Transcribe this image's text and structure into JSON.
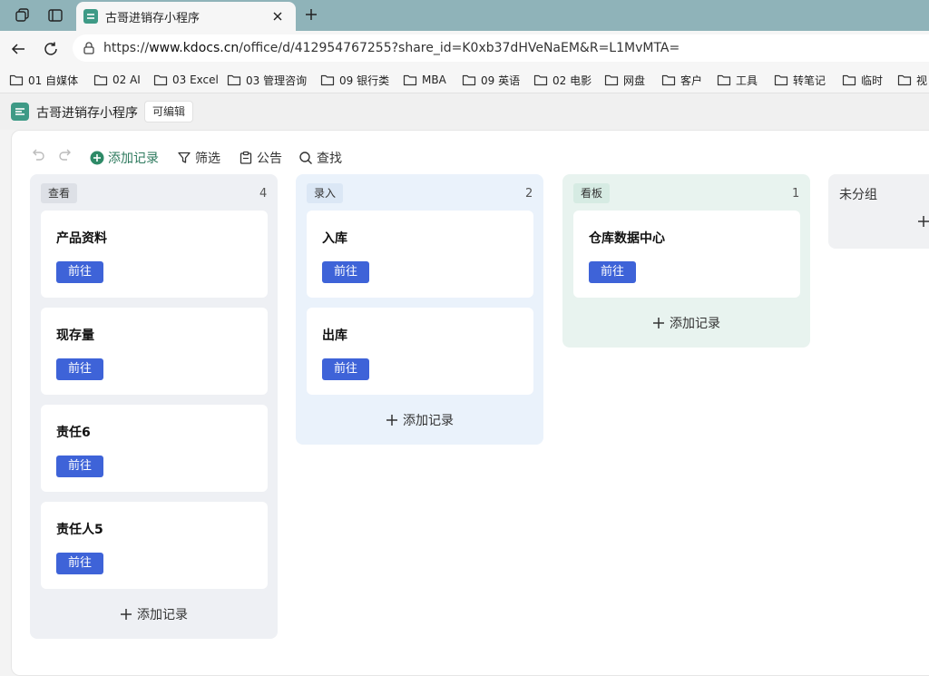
{
  "browser": {
    "tab_title": "古哥进销存小程序",
    "url_prefix": "https://",
    "url_domain": "www.kdocs.cn",
    "url_path": "/office/d/412954767255?share_id=K0xb37dHVeNaEM&R=L1MvMTA=",
    "bookmarks": [
      "01 自媒体",
      "02 AI",
      "03 Excel",
      "03 管理咨询",
      "09 银行类",
      "MBA",
      "09 英语",
      "02 电影",
      "网盘",
      "客户",
      "工具",
      "转笔记",
      "临时",
      "视"
    ]
  },
  "app": {
    "title": "古哥进销存小程序",
    "edit_badge": "可编辑"
  },
  "toolbar": {
    "add_record": "添加记录",
    "filter": "筛选",
    "notice": "公告",
    "search": "查找"
  },
  "columns": [
    {
      "tag": "查看",
      "count": "4",
      "cards": [
        {
          "title": "产品资料",
          "button": "前往"
        },
        {
          "title": "现存量",
          "button": "前往"
        },
        {
          "title": "责任6",
          "button": "前往"
        },
        {
          "title": "责任人5",
          "button": "前往"
        }
      ],
      "add_label": "添加记录"
    },
    {
      "tag": "录入",
      "count": "2",
      "cards": [
        {
          "title": "入库",
          "button": "前往"
        },
        {
          "title": "出库",
          "button": "前往"
        }
      ],
      "add_label": "添加记录"
    },
    {
      "tag": "看板",
      "count": "1",
      "cards": [
        {
          "title": "仓库数据中心",
          "button": "前往"
        }
      ],
      "add_label": "添加记录"
    },
    {
      "tag": "未分组",
      "count": "",
      "cards": [],
      "add_label": ""
    }
  ],
  "colors": {
    "accent": "#3e63d8",
    "brand": "#3e9a86",
    "col_view_bg": "#eef0f4",
    "col_entry_bg": "#eaf2fb",
    "col_board_bg": "#e8f3ef",
    "col_ungrouped_bg": "#f0f1f3"
  }
}
